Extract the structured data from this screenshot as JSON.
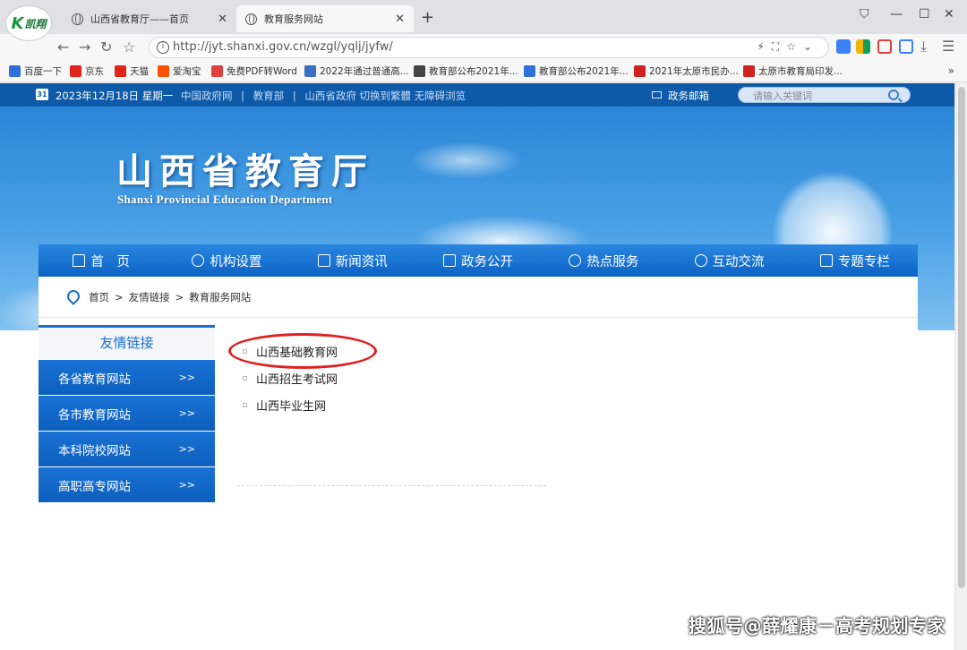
{
  "browser": {
    "logo_text": "凯翔",
    "tabs": [
      {
        "label": "山西省教育厅——首页"
      },
      {
        "label": "教育服务网站"
      }
    ],
    "url": "http://jyt.shanxi.gov.cn/wzgl/yqlj/jyfw/",
    "bookmarks": [
      {
        "label": "百度一下",
        "icon_color": "#2f6fd8"
      },
      {
        "label": "京东",
        "icon_color": "#e1251b"
      },
      {
        "label": "天猫",
        "icon_color": "#e1251b"
      },
      {
        "label": "爱淘宝",
        "icon_color": "#ff5000"
      },
      {
        "label": "免费PDF转Word",
        "icon_color": "#e04040"
      },
      {
        "label": "2022年通过普通高...",
        "icon_color": "#3b6fc4"
      },
      {
        "label": "教育部公布2021年...",
        "icon_color": "#444444"
      },
      {
        "label": "教育部公布2021年...",
        "icon_color": "#2f6fd8"
      },
      {
        "label": "2021年太原市民办...",
        "icon_color": "#d02020"
      },
      {
        "label": "太原市教育局印发...",
        "icon_color": "#d02020"
      }
    ]
  },
  "top_strip": {
    "date": "2023年12月18日 星期一",
    "links": [
      "中国政府网",
      "|",
      "教育部",
      "|",
      "山西省政府 切换到繁體 无障碍浏览"
    ],
    "mail": "政务邮箱",
    "search_placeholder": "请输入关键词"
  },
  "banner": {
    "title": "山西省教育厅",
    "subtitle": "Shanxi Provincial Education Department"
  },
  "nav": [
    {
      "label": "首　页",
      "icon": "home-icon"
    },
    {
      "label": "机构设置",
      "icon": "org-icon"
    },
    {
      "label": "新闻资讯",
      "icon": "news-icon"
    },
    {
      "label": "政务公开",
      "icon": "gov-icon"
    },
    {
      "label": "热点服务",
      "icon": "service-icon"
    },
    {
      "label": "互动交流",
      "icon": "link-icon"
    },
    {
      "label": "专题专栏",
      "icon": "bookmark-icon"
    }
  ],
  "breadcrumb": [
    "首页",
    "友情链接",
    "教育服务网站"
  ],
  "sidebar": {
    "title": "友情链接",
    "items": [
      {
        "label": "各省教育网站",
        "arrow": ">>"
      },
      {
        "label": "各市教育网站",
        "arrow": ">>"
      },
      {
        "label": "本科院校网站",
        "arrow": ">>"
      },
      {
        "label": "高职高专网站",
        "arrow": ">>"
      }
    ]
  },
  "links": [
    {
      "label": "山西基础教育网"
    },
    {
      "label": "山西招生考试网"
    },
    {
      "label": "山西毕业生网"
    }
  ],
  "watermark": "搜狐号@薛耀康－高考规划专家"
}
